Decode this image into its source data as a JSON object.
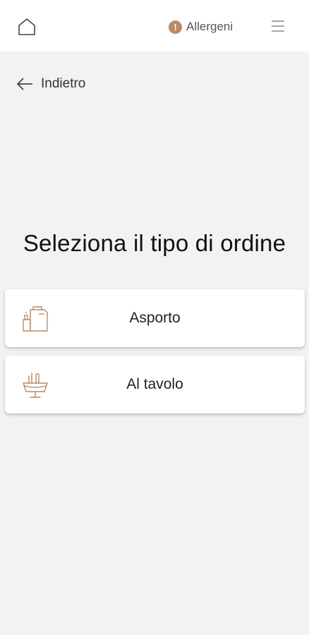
{
  "header": {
    "home_icon": "home-icon",
    "allergens": {
      "label": "Allergeni",
      "icon": "exclamation-circle-icon",
      "icon_glyph": "!",
      "icon_color": "#b98a66"
    },
    "menu_icon": "hamburger-menu-icon"
  },
  "back": {
    "label": "Indietro",
    "icon": "arrow-left-icon"
  },
  "title": "Seleziona il tipo di ordine",
  "options": [
    {
      "label": "Asporto",
      "icon": "takeaway-bag-icon"
    },
    {
      "label": "Al tavolo",
      "icon": "dining-table-icon"
    }
  ],
  "colors": {
    "accent": "#b98a66",
    "background": "#f2f2f2",
    "card": "#ffffff"
  }
}
